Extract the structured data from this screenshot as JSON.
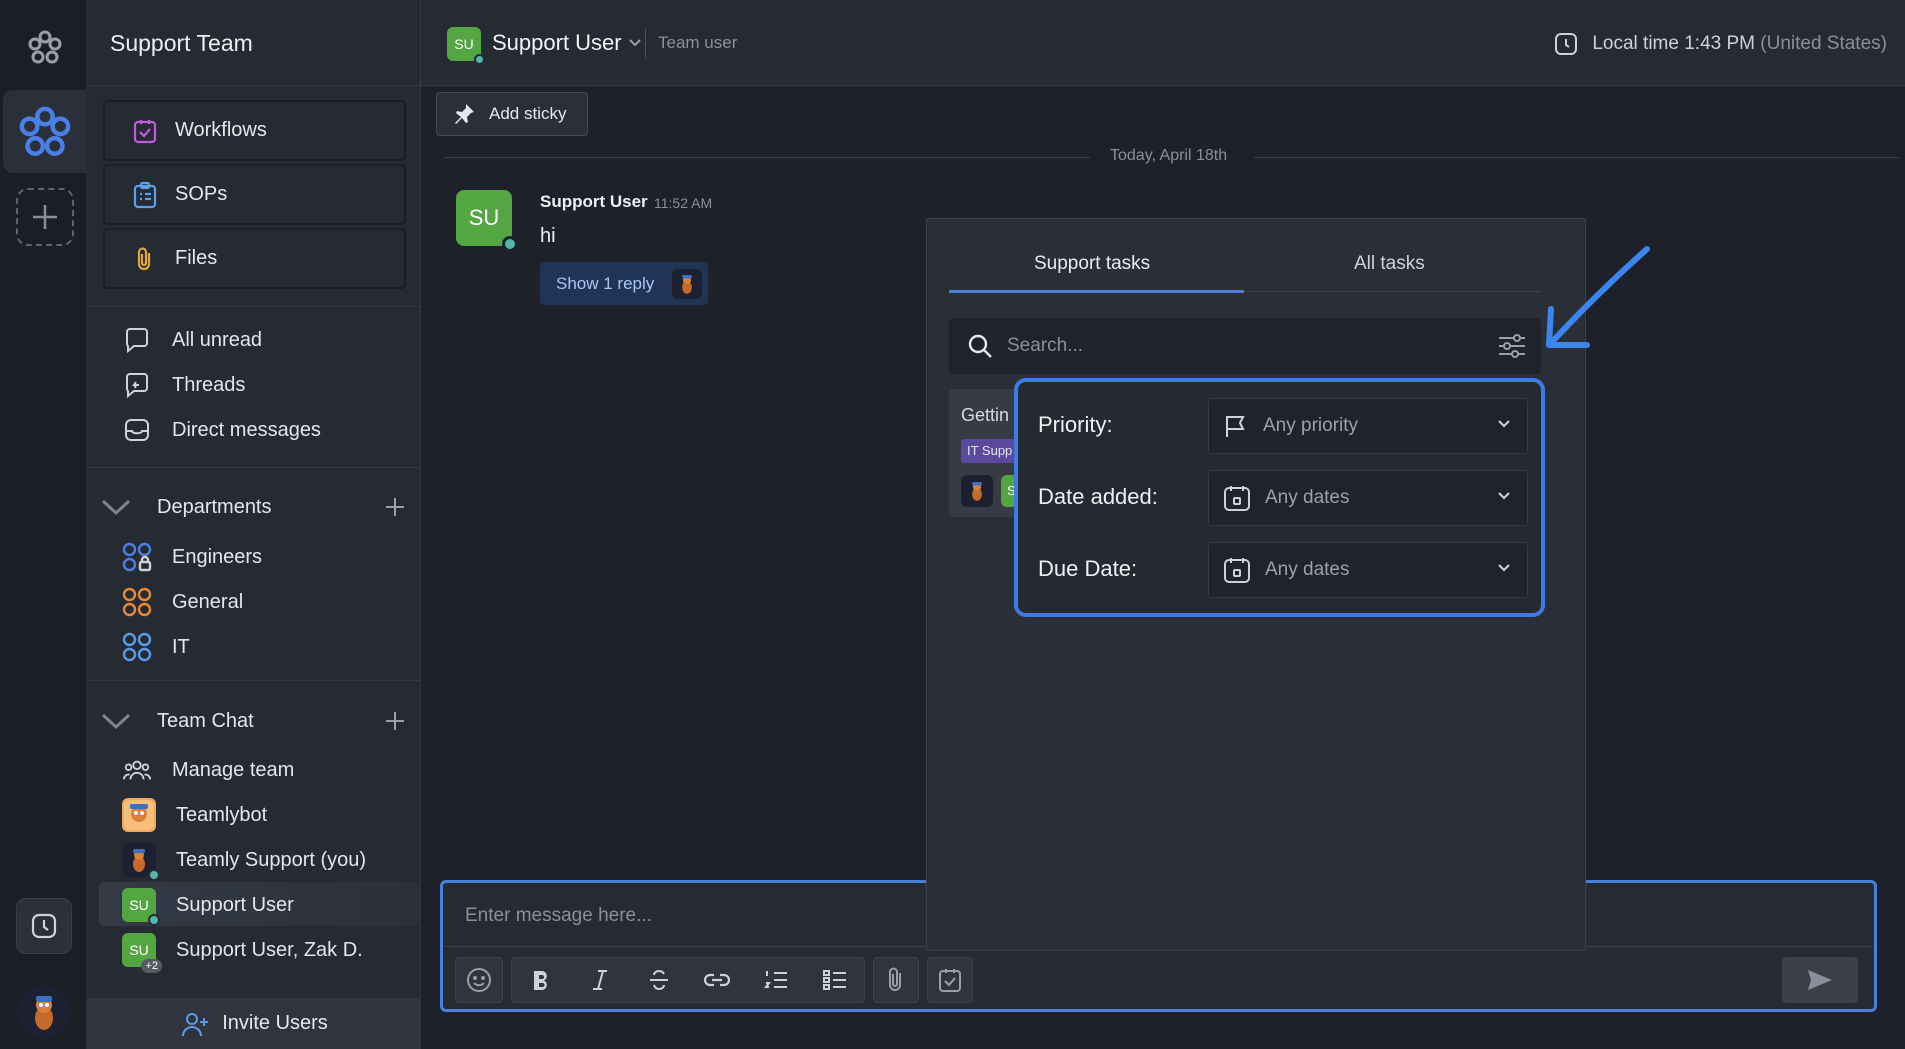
{
  "rail": {
    "icons": [
      "flower-logo-icon",
      "workspace-icon",
      "add-workspace-icon",
      "clock-icon",
      "user-avatar"
    ]
  },
  "sidebar": {
    "team_name": "Support Team",
    "tools": [
      {
        "label": "Workflows",
        "icon": "workflow-icon"
      },
      {
        "label": "SOPs",
        "icon": "clipboard-icon"
      },
      {
        "label": "Files",
        "icon": "paperclip-icon"
      }
    ],
    "nav": [
      {
        "label": "All unread",
        "icon": "chat-bubble-icon"
      },
      {
        "label": "Threads",
        "icon": "threads-icon"
      },
      {
        "label": "Direct messages",
        "icon": "inbox-icon"
      }
    ],
    "departments": {
      "title": "Departments",
      "items": [
        {
          "label": "Engineers",
          "color": "#4f7ee6"
        },
        {
          "label": "General",
          "color": "#e88a3c"
        },
        {
          "label": "IT",
          "color": "#5b9ce8"
        }
      ]
    },
    "team_chat": {
      "title": "Team Chat",
      "items": [
        {
          "label": "Manage team"
        },
        {
          "label": "Teamlybot"
        },
        {
          "label": "Teamly Support (you)"
        },
        {
          "label": "Support User",
          "initials": "SU"
        },
        {
          "label": "Support User, Zak D.",
          "initials": "SU",
          "badge": "+2"
        }
      ]
    },
    "invite_label": "Invite Users"
  },
  "header": {
    "initials": "SU",
    "title": "Support User",
    "subtitle": "Team user",
    "local_time_label": "Local time 1:43 PM",
    "local_time_region": "(United States)"
  },
  "chat": {
    "add_sticky_label": "Add sticky",
    "date_separator": "Today, April 18th",
    "message": {
      "initials": "SU",
      "author": "Support User",
      "time": "11:52 AM",
      "text": "hi",
      "reply_label": "Show 1 reply"
    },
    "composer_placeholder": "Enter message here..."
  },
  "task_panel": {
    "tabs": [
      "Support tasks",
      "All tasks"
    ],
    "active_tab": "Support tasks",
    "search_placeholder": "Search...",
    "card": {
      "title": "Gettin",
      "tag": "IT Supp",
      "initials": "S"
    },
    "filters": [
      {
        "label": "Priority:",
        "value": "Any priority",
        "icon": "flag-icon"
      },
      {
        "label": "Date added:",
        "value": "Any dates",
        "icon": "calendar-icon"
      },
      {
        "label": "Due Date:",
        "value": "Any dates",
        "icon": "calendar-icon"
      }
    ]
  },
  "colors": {
    "accent": "#4a7fdc",
    "highlight": "#3c7be6",
    "avatar_green": "#53a642",
    "online": "#55b5ad"
  }
}
